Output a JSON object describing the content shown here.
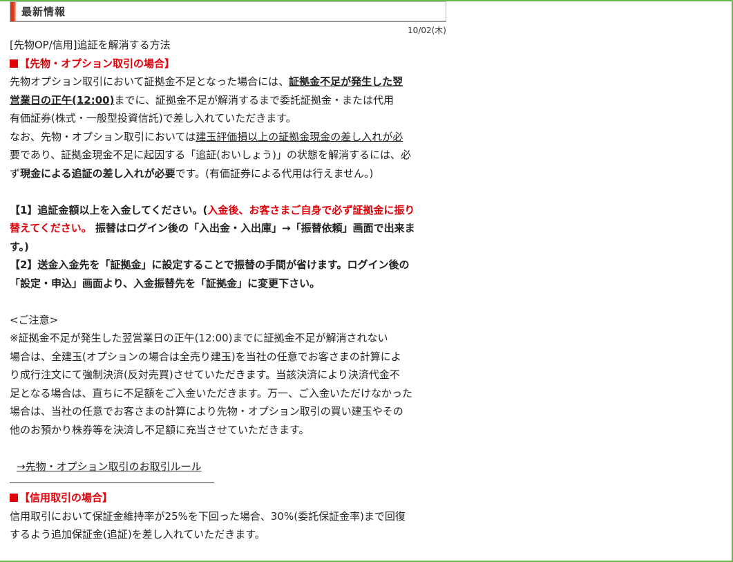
{
  "header": {
    "title": "最新情報"
  },
  "date": "10/02(木)",
  "article": {
    "title": "[先物OP/信用]追証を解消する方法",
    "section1_heading": "【先物・オプション取引の場合】",
    "p1": {
      "a": "先物オプション取引において証拠金不足となった場合には、",
      "b": "証拠金不足が発生した翌",
      "c": "営業日の正午(12:00)",
      "d": "までに、証拠金不足が解消するまで委託証拠金・または代用",
      "e": "有価証券(株式・一般型投資信託)で差し入れていただきます。"
    },
    "p2": {
      "a": "なお、先物・オプション取引においては",
      "b": "建玉評価損以上の証拠金現金の差し入れが必",
      "c": "要であり、証拠金現金不足に起因する「追証(おいしょう)」の状態を解消するには、必",
      "d": "ず",
      "e": "現金による追証の差し入れが必要",
      "f": "です。(有価証券による代用は行えません。)"
    },
    "step1": {
      "a": "【1】追証金額以上を入金してください。(",
      "b": "入金後、お客さまご自身で必ず証拠金に振り",
      "c": "替えてください。",
      "d": "振替はログイン後の「入出金・入出庫」→「振替依頼」画面で出来ま",
      "e": "す。)"
    },
    "step2": {
      "a": "【2】送金入金先を「証拠金」に設定することで振替の手間が省けます。ログイン後の",
      "b": "「設定・申込」画面より、入金振替先を「証拠金」に変更下さい。"
    },
    "notice_heading": "<ご注意>",
    "notice_lines": [
      "※証拠金不足が発生した翌営業日の正午(12:00)までに証拠金不足が解消されない",
      "場合は、全建玉(オプションの場合は全売り建玉)を当社の任意でお客さまの計算によ",
      "り成行注文にて強制決済(反対売買)させていただきます。当該決済により決済代金不",
      "足となる場合は、直ちに不足額をご入金いただきます。万一、ご入金いただけなかった",
      "場合は、当社の任意でお客さまの計算により先物・オプション取引の買い建玉やその",
      "他のお預かり株券等を決済し不足額に充当させていただきます。"
    ],
    "rule_link": "→先物・オプション取引のお取引ルール",
    "section2_heading": "【信用取引の場合】",
    "p3": [
      "信用取引において保証金維持率が25%を下回った場合、30%(委託保証金率)まで回復",
      "するよう追加保証金(追証)を差し入れていただきます。"
    ]
  }
}
